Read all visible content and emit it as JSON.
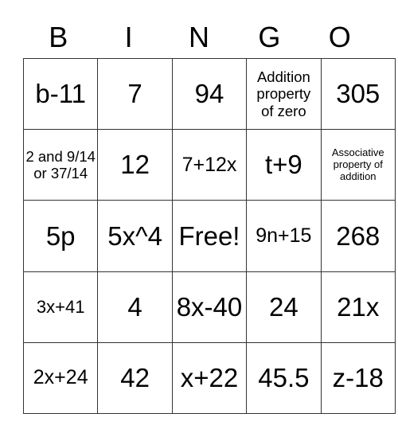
{
  "header": [
    "B",
    "I",
    "N",
    "G",
    "O"
  ],
  "rows": [
    [
      {
        "t": "b-11",
        "s": "xl"
      },
      {
        "t": "7",
        "s": "xl"
      },
      {
        "t": "94",
        "s": "xl"
      },
      {
        "t": "Addition property of zero",
        "s": "sm"
      },
      {
        "t": "305",
        "s": "xl"
      }
    ],
    [
      {
        "t": "2 and 9/14 or 37/14",
        "s": "sm"
      },
      {
        "t": "12",
        "s": "xl"
      },
      {
        "t": "7+12x",
        "s": "lg"
      },
      {
        "t": "t+9",
        "s": "xl"
      },
      {
        "t": "Associative property of addition",
        "s": "xs"
      }
    ],
    [
      {
        "t": "5p",
        "s": "xl"
      },
      {
        "t": "5x^4",
        "s": "xl"
      },
      {
        "t": "Free!",
        "s": "xl"
      },
      {
        "t": "9n+15",
        "s": "lg"
      },
      {
        "t": "268",
        "s": "xl"
      }
    ],
    [
      {
        "t": "3x+41",
        "s": "md"
      },
      {
        "t": "4",
        "s": "xl"
      },
      {
        "t": "8x-40",
        "s": "xl"
      },
      {
        "t": "24",
        "s": "xl"
      },
      {
        "t": "21x",
        "s": "xl"
      }
    ],
    [
      {
        "t": "2x+24",
        "s": "lg"
      },
      {
        "t": "42",
        "s": "xl"
      },
      {
        "t": "x+22",
        "s": "xl"
      },
      {
        "t": "45.5",
        "s": "xl"
      },
      {
        "t": "z-18",
        "s": "xl"
      }
    ]
  ]
}
